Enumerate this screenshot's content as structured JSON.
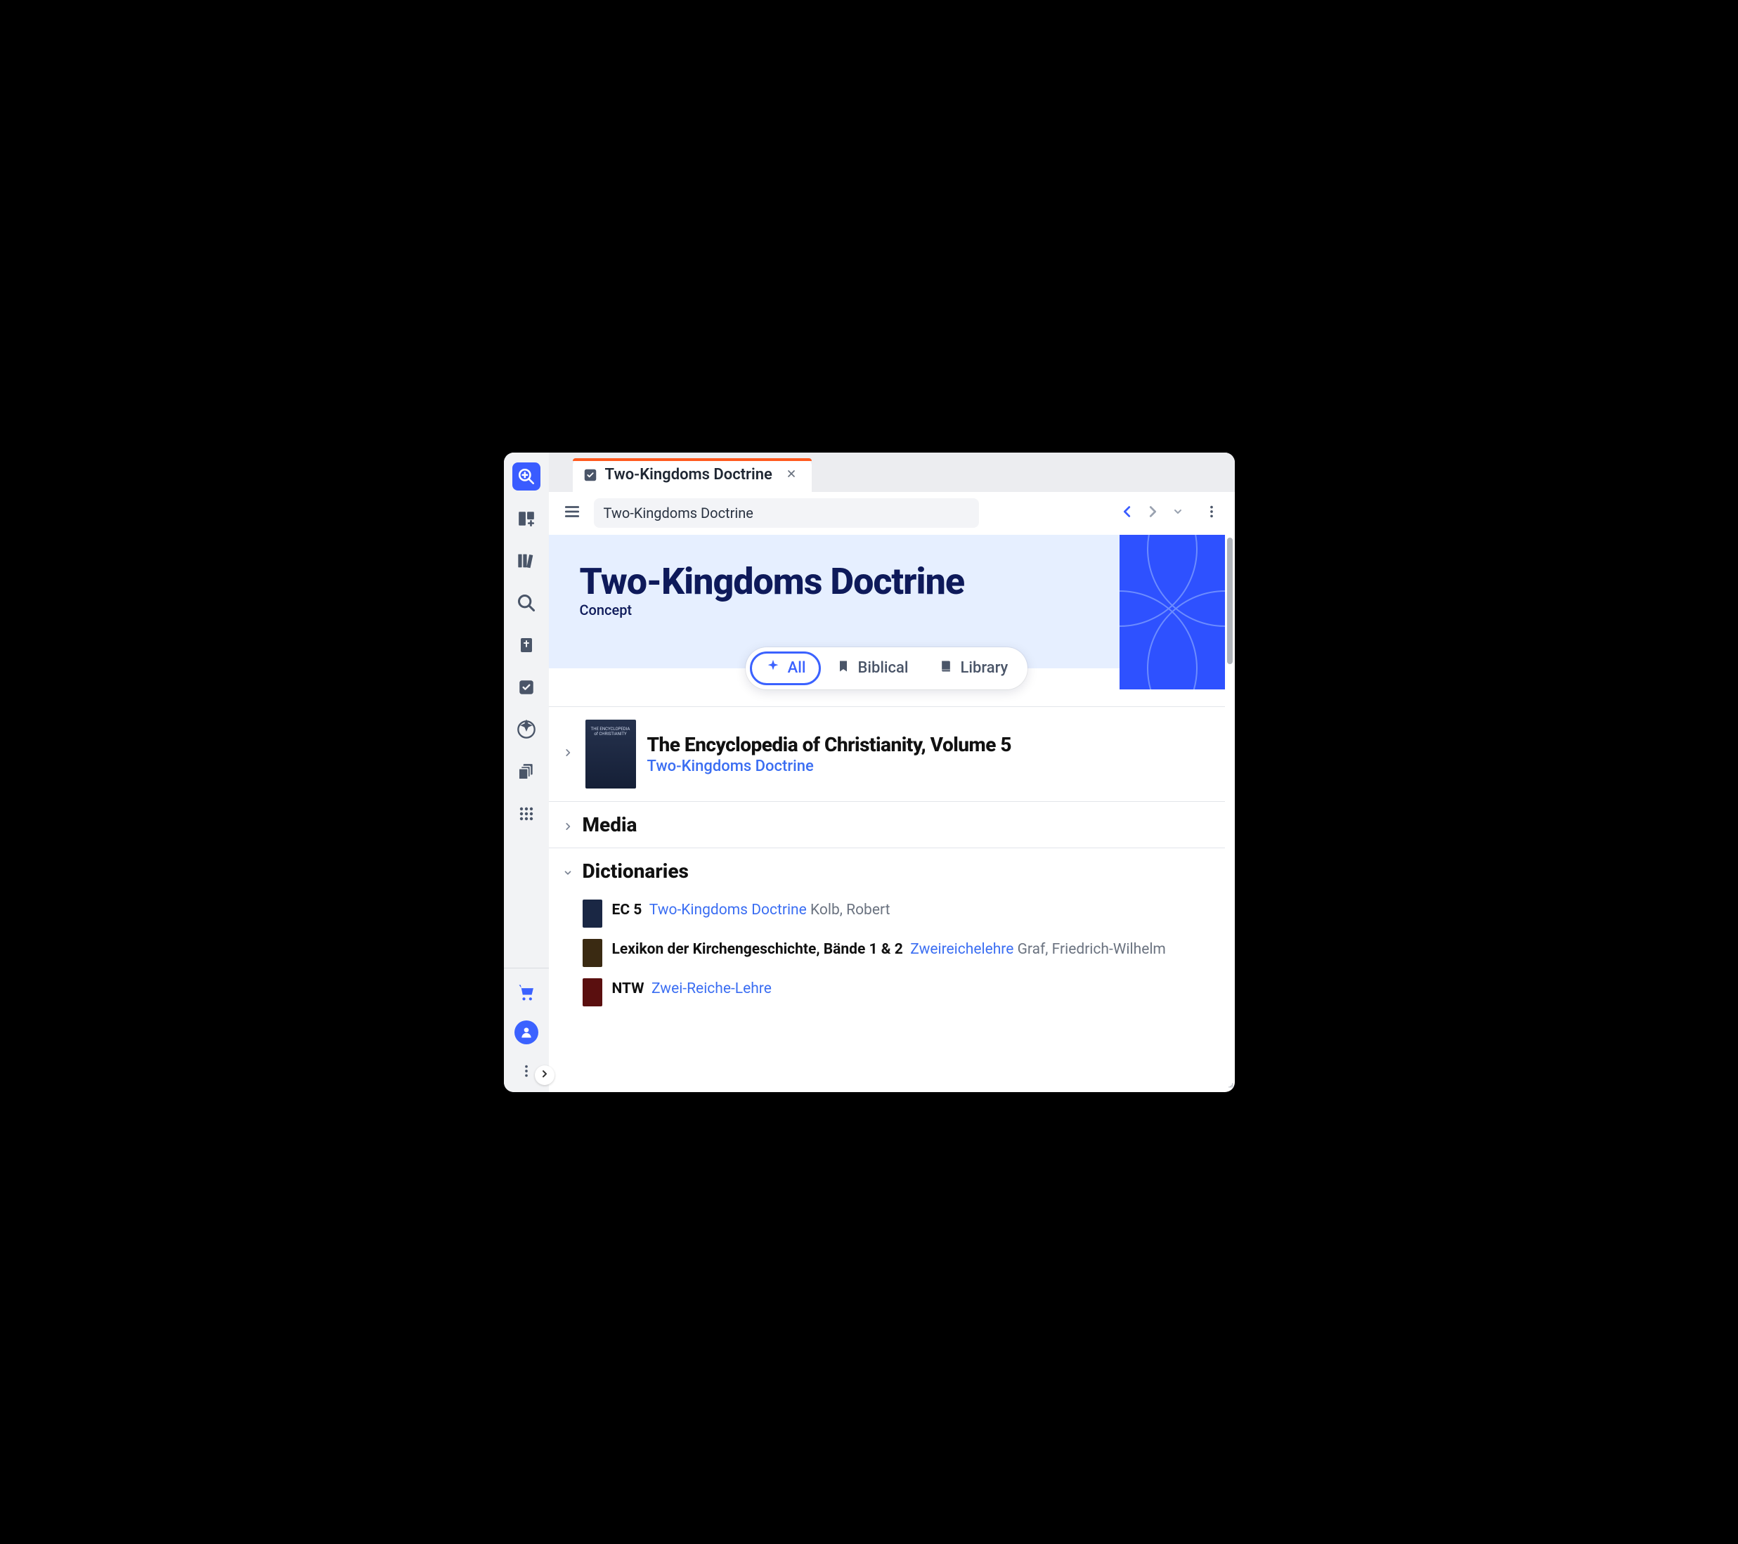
{
  "tab": {
    "label": "Two-Kingdoms Doctrine"
  },
  "toolbar": {
    "input_value": "Two-Kingdoms Doctrine"
  },
  "hero": {
    "title": "Two-Kingdoms Doctrine",
    "subtitle": "Concept"
  },
  "filters": {
    "all": "All",
    "biblical": "Biblical",
    "library": "Library"
  },
  "key_article": {
    "title": "The Encyclopedia of Christianity, Volume 5",
    "link": "Two-Kingdoms Doctrine",
    "thumb_text": "THE ENCYCLOPEDIA of CHRISTIANITY"
  },
  "sections": {
    "media": "Media",
    "dictionaries": "Dictionaries"
  },
  "dict": [
    {
      "abbr": "EC 5",
      "link": "Two-Kingdoms Doctrine",
      "author": "Kolb, Robert"
    },
    {
      "abbr": "Lexikon der Kirchengeschichte, Bände 1 & 2",
      "link": "Zweireichelehre",
      "author": "Graf, Friedrich-Wilhelm"
    },
    {
      "abbr": "NTW",
      "link": "Zwei-Reiche-Lehre",
      "author": ""
    }
  ]
}
